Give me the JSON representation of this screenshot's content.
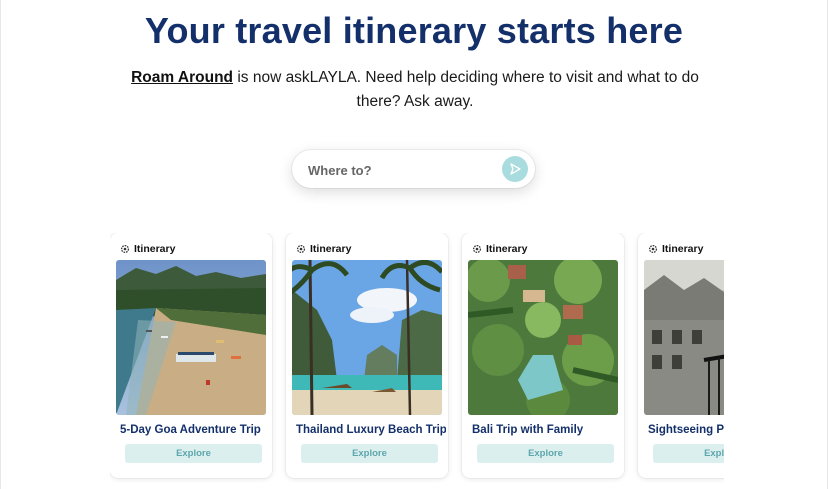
{
  "hero": {
    "title": "Your travel itinerary starts here",
    "brand_link": "Roam Around",
    "subtitle_text": " is now askLAYLA. Need help deciding where to visit and what to do there? Ask away."
  },
  "search": {
    "placeholder": "Where to?",
    "send_icon": "send-icon"
  },
  "cards": [
    {
      "tag": "Itinerary",
      "title": "5-Day Goa Adventure Trip",
      "button": "Explore",
      "image": "goa-beach-photo"
    },
    {
      "tag": "Itinerary",
      "title": "Thailand Luxury Beach Trip",
      "button": "Explore",
      "image": "thailand-beach-photo"
    },
    {
      "tag": "Itinerary",
      "title": "Bali Trip with Family",
      "button": "Explore",
      "image": "bali-resort-photo"
    },
    {
      "tag": "Itinerary",
      "title": "Sightseeing P",
      "button": "Explore",
      "image": "city-balcony-photo"
    }
  ],
  "colors": {
    "title": "#14306b",
    "accent": "#a9dcdf",
    "button_bg": "#dcefef",
    "button_text": "#5ba6ac"
  }
}
